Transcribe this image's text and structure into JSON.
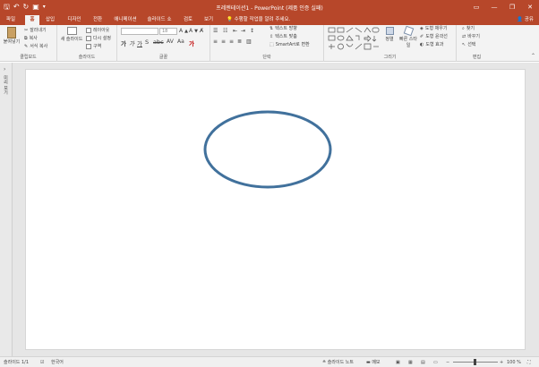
{
  "window": {
    "title": "프레젠테이션1 - PowerPoint (제품 인증 실패)"
  },
  "tabs": [
    {
      "label": "파일"
    },
    {
      "label": "홈",
      "active": true
    },
    {
      "label": "삽입"
    },
    {
      "label": "디자인"
    },
    {
      "label": "전환"
    },
    {
      "label": "애니메이션"
    },
    {
      "label": "슬라이드 쇼"
    },
    {
      "label": "검토"
    },
    {
      "label": "보기"
    }
  ],
  "tellme": {
    "text": "수행할 작업을 알려 주세요."
  },
  "share": {
    "label": "공유"
  },
  "ribbon": {
    "clipboard": {
      "label": "클립보드",
      "paste": "붙여넣기",
      "cut": "잘라내기",
      "copy": "복사",
      "format_painter": "서식 복사"
    },
    "slides": {
      "label": "슬라이드",
      "new_slide": "새 슬라이드",
      "layout": "레이아웃",
      "reset": "다시 설정",
      "section": "구역"
    },
    "font": {
      "label": "글꼴",
      "font_name": "",
      "font_size": "18"
    },
    "paragraph": {
      "label": "단락",
      "text_direction": "텍스트 방향",
      "align_text": "텍스트 맞춤",
      "smartart": "SmartArt로 변환"
    },
    "drawing": {
      "label": "그리기",
      "arrange": "정렬",
      "quick_styles": "빠른 스타일",
      "shape_fill": "도형 채우기",
      "shape_outline": "도형 윤곽선",
      "shape_effects": "도형 효과"
    },
    "editing": {
      "label": "편집",
      "find": "찾기",
      "replace": "바꾸기",
      "select": "선택"
    }
  },
  "side_pane": {
    "label": "미리 보기"
  },
  "slide": {
    "shape": "ellipse",
    "outline_color": "#41719c"
  },
  "status": {
    "slide_counter": "슬라이드 1/1",
    "language": "한국어",
    "notes": "슬라이드 노트",
    "comments": "메모",
    "zoom": "100 %"
  },
  "colors": {
    "accent": "#b7472a",
    "ribbon_bg": "#f3f3f3"
  }
}
